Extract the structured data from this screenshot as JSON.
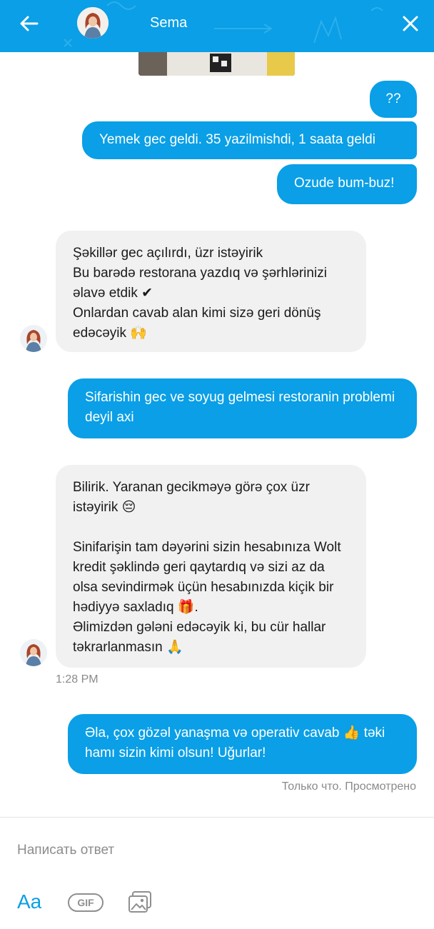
{
  "header": {
    "contact_name": "Sema",
    "accent_color": "#0a9fe6",
    "back_icon": "arrow-left-icon",
    "close_icon": "close-icon"
  },
  "messages": [
    {
      "direction": "out",
      "text": "??"
    },
    {
      "direction": "out",
      "text": "Yemek gec geldi. 35 yazilmishdi, 1 saata geldi"
    },
    {
      "direction": "out",
      "text": "Ozude bum-buz!"
    },
    {
      "direction": "in",
      "text": "Şəkillər gec açılırdı, üzr istəyirik\nBu barədə restorana yazdıq və şərhlərinizi əlavə etdik ✔\nOnlardan cavab alan kimi sizə geri dönüş edəcəyik 🙌"
    },
    {
      "direction": "out",
      "text": "Sifarishin gec ve soyug gelmesi restoranin problemi deyil axi"
    },
    {
      "direction": "in",
      "text": "Bilirik. Yaranan gecikməyə görə çox üzr istəyirik 😔\n\nSinifarişin tam dəyərini sizin hesabınıza Wolt kredit şəklində geri qaytardıq və sizi az da olsa sevindirmək üçün hesabınızda kiçik bir hədiyyə saxladıq 🎁.\nƏlimizdən gələni edəcəyik ki, bu cür hallar təkrarlanmasın 🙏"
    },
    {
      "direction": "out",
      "text": "Əla, çox gözəl yanaşma və operativ cavab 👍 təki hamı sizin kimi olsun! Uğurlar!"
    }
  ],
  "timestamp": "1:28 PM",
  "status_text": "Только что. Просмотрено",
  "composer": {
    "placeholder": "Написать ответ",
    "format_label": "Aa",
    "gif_label": "GIF",
    "photo_icon": "photo-gallery-icon"
  }
}
